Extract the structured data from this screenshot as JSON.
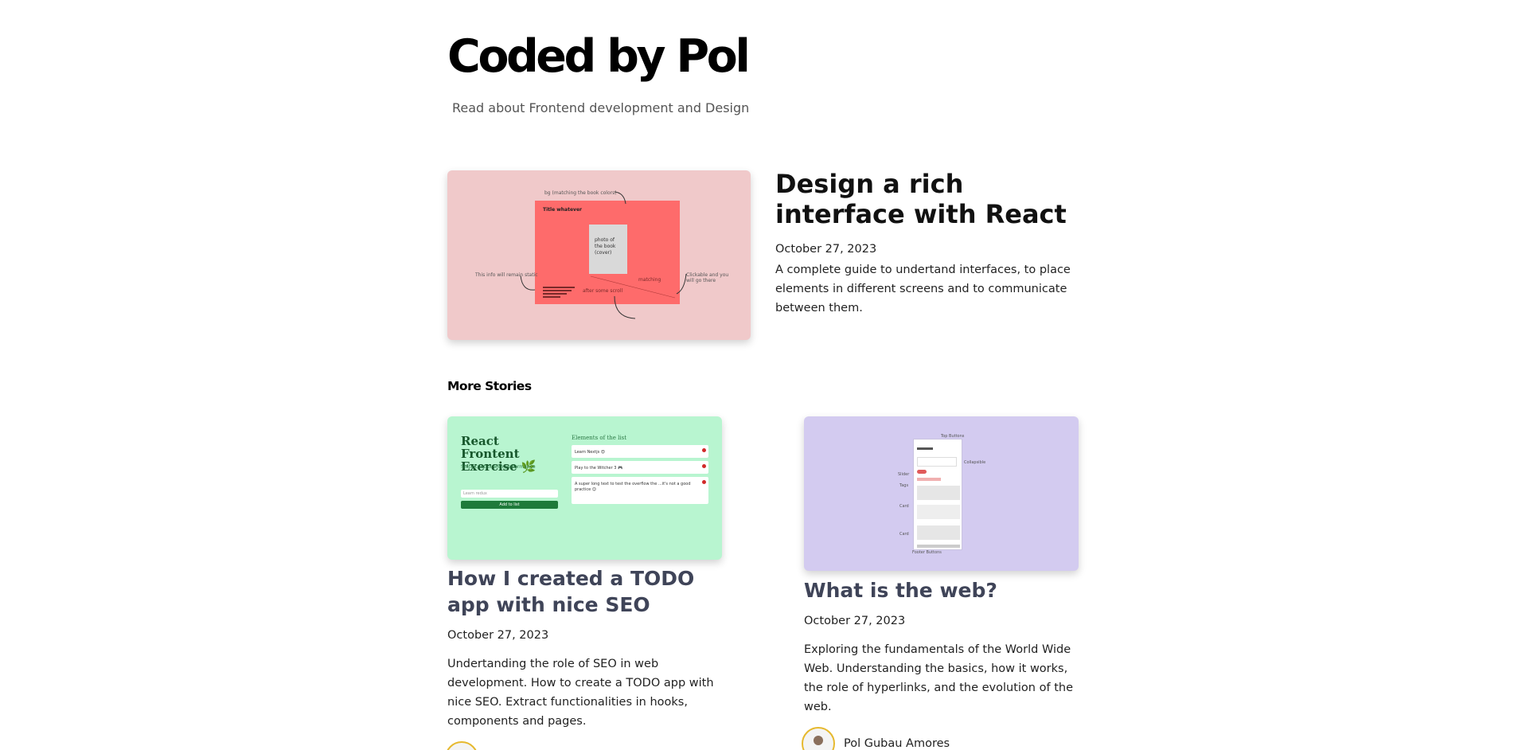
{
  "site": {
    "title": "Coded by Pol",
    "subtitle": "Read about Frontend development and Design"
  },
  "hero": {
    "title": "Design a rich interface with React",
    "date": "October 27, 2023",
    "excerpt": "A complete guide to undertand interfaces, to place elements in different screens and to communicate between them.",
    "illustration": {
      "notes": [
        "bg (matching the book colors)",
        "Title whatever",
        "photo of the book (cover)",
        "This info will remain static",
        "Clickable and you will go there",
        "after some scroll",
        "matching"
      ],
      "colors": {
        "background": "#f0c9ca",
        "panel": "#fe6b6b",
        "cover": "#d9d9d9"
      }
    }
  },
  "section": {
    "more_stories": "More Stories"
  },
  "stories": [
    {
      "title": "How I created a TODO app with nice SEO",
      "date": "October 27, 2023",
      "excerpt": "Undertanding the role of SEO in web development. How to create a TODO app with nice SEO. Extract functionalities in hooks, components and pages.",
      "thumb": {
        "heading": "React Frontent Exercise 🌿",
        "tagline": "State control with performance",
        "list_title": "Elements of the list",
        "items": [
          "Learn Nextjs 😍",
          "Play to the Witcher 3 🎮",
          "A super long text to test the overflow the ...it's not a good practice 😉"
        ],
        "button": "Add to list",
        "input_placeholder": "Learn redux"
      }
    },
    {
      "title": "What is the web?",
      "date": "October 27, 2023",
      "excerpt": "Exploring the fundamentals of the World Wide Web. Understanding the basics, how it works, the role of hyperlinks, and the evolution of the web.",
      "author": "Pol Gubau Amores",
      "thumb": {
        "notes": [
          "Top Buttons",
          "Collapsible",
          "Slider",
          "Tags",
          "Card",
          "Card",
          "Footer Buttons"
        ]
      }
    }
  ]
}
